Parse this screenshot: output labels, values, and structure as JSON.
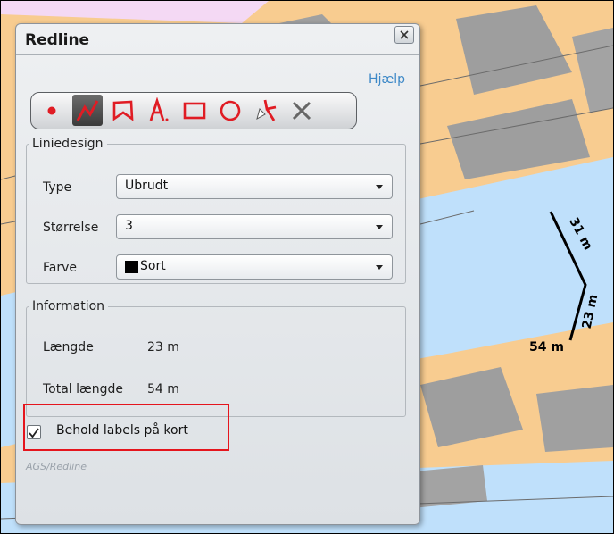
{
  "panel": {
    "title": "Redline",
    "help_link": "Hjælp",
    "toolbar": {
      "tools": [
        {
          "name": "point",
          "icon": "point-icon"
        },
        {
          "name": "line",
          "icon": "line-icon",
          "active": true
        },
        {
          "name": "polygon",
          "icon": "polygon-icon"
        },
        {
          "name": "text",
          "icon": "text-icon"
        },
        {
          "name": "rectangle",
          "icon": "rectangle-icon"
        },
        {
          "name": "circle",
          "icon": "circle-icon"
        },
        {
          "name": "move",
          "icon": "move-icon"
        },
        {
          "name": "delete",
          "icon": "delete-icon"
        }
      ],
      "accent_color": "#e01c24"
    },
    "liniedesign": {
      "legend": "Liniedesign",
      "type_label": "Type",
      "type_value": "Ubrudt",
      "size_label": "Størrelse",
      "size_value": "3",
      "color_label": "Farve",
      "color_value": "Sort",
      "color_swatch": "#000000"
    },
    "information": {
      "legend": "Information",
      "length_label": "Længde",
      "length_value": "23 m",
      "total_label": "Total længde",
      "total_value": "54 m"
    },
    "keep_labels": {
      "label": "Behold labels på kort",
      "checked": true
    },
    "footer": "AGS/Redline"
  },
  "map": {
    "segment_labels": [
      "31 m",
      "23 m"
    ],
    "total_label": "54 m",
    "colors": {
      "water": "#bfe0fb",
      "land": "#f8cc90",
      "buildings": "#9c9c9c",
      "road_line": "#6b6b6b",
      "redline": "#000000"
    }
  }
}
